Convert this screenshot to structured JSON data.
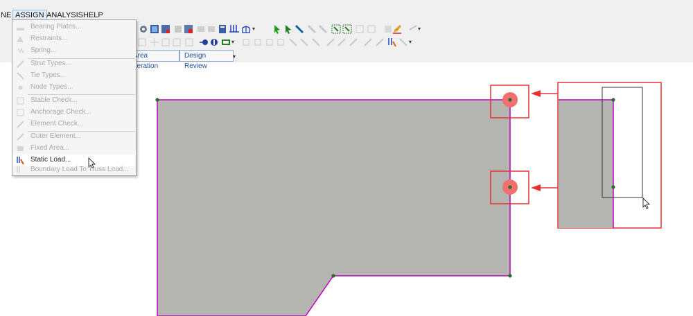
{
  "menubar": {
    "items": [
      {
        "label": "NE"
      },
      {
        "label": "ASSIGN"
      },
      {
        "label": "ANALYSIS"
      },
      {
        "label": "HELP"
      }
    ]
  },
  "tabs": [
    {
      "label": "Area Iteration"
    },
    {
      "label": "Design Review"
    }
  ],
  "assign_menu": {
    "items": [
      {
        "label": "Bearing Plates...",
        "enabled": false,
        "icon": "bearing-plate-icon"
      },
      {
        "label": "Restraints...",
        "enabled": false,
        "icon": "restraint-icon"
      },
      {
        "label": "Spring...",
        "enabled": false,
        "icon": "spring-icon"
      },
      {
        "label": "Strut Types...",
        "enabled": false,
        "icon": "strut-type-icon"
      },
      {
        "label": "Tie Types...",
        "enabled": false,
        "icon": "tie-type-icon"
      },
      {
        "label": "Node Types...",
        "enabled": false,
        "icon": "node-type-icon"
      },
      {
        "label": "Stable Check...",
        "enabled": false,
        "icon": "stable-check-icon"
      },
      {
        "label": "Anchorage Check...",
        "enabled": false,
        "icon": "anchorage-check-icon"
      },
      {
        "label": "Element Check...",
        "enabled": false,
        "icon": "element-check-icon"
      },
      {
        "label": "Outer Element...",
        "enabled": false,
        "icon": "outer-element-icon"
      },
      {
        "label": "Fixed Area...",
        "enabled": false,
        "icon": "fixed-area-icon"
      },
      {
        "label": "Static Load...",
        "enabled": true,
        "hovered": true,
        "icon": "static-load-icon"
      },
      {
        "label": "Boundary Load To Truss Load...",
        "enabled": false,
        "icon": "boundary-load-icon"
      }
    ]
  },
  "colors": {
    "shape_fill": "#b4b4b0",
    "shape_edge": "#c000c0",
    "node": "#2a6a2a",
    "highlight": "#e83030",
    "highlight_dot": "#f07070"
  }
}
